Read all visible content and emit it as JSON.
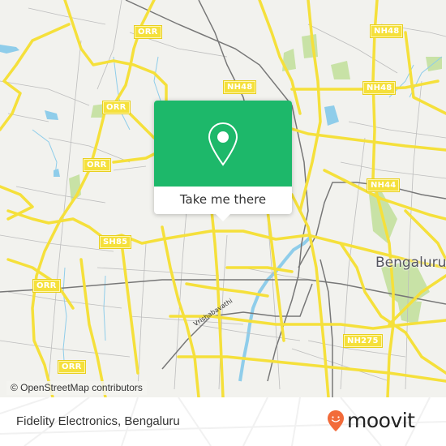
{
  "map": {
    "road_shields": [
      {
        "label": "ORR",
        "id": "orr-1"
      },
      {
        "label": "ORR",
        "id": "orr-2"
      },
      {
        "label": "ORR",
        "id": "orr-3"
      },
      {
        "label": "ORR",
        "id": "orr-4"
      },
      {
        "label": "ORR",
        "id": "orr-5"
      },
      {
        "label": "NH48",
        "id": "nh48-1"
      },
      {
        "label": "NH48",
        "id": "nh48-2"
      },
      {
        "label": "NH48",
        "id": "nh48-3"
      },
      {
        "label": "NH44",
        "id": "nh44"
      },
      {
        "label": "SH85",
        "id": "sh85"
      },
      {
        "label": "NH275",
        "id": "nh275"
      }
    ],
    "city_label": "Bengaluru",
    "river_label": "Vrishabavathi",
    "attribution": "© OpenStreetMap contributors",
    "colors": {
      "background": "#f2f2ee",
      "major_road": "#f5e03b",
      "minor_road": "#b8b8b8",
      "water": "#8fcdea",
      "park": "#c8e2a6",
      "rail": "#777777"
    }
  },
  "popup": {
    "cta_label": "Take me there",
    "icon": "map-pin-icon",
    "accent_color": "#1db86a"
  },
  "footer": {
    "place_name": "Fidelity Electronics, Bengaluru",
    "brand": "moovit",
    "brand_color": "#f26b3a"
  }
}
